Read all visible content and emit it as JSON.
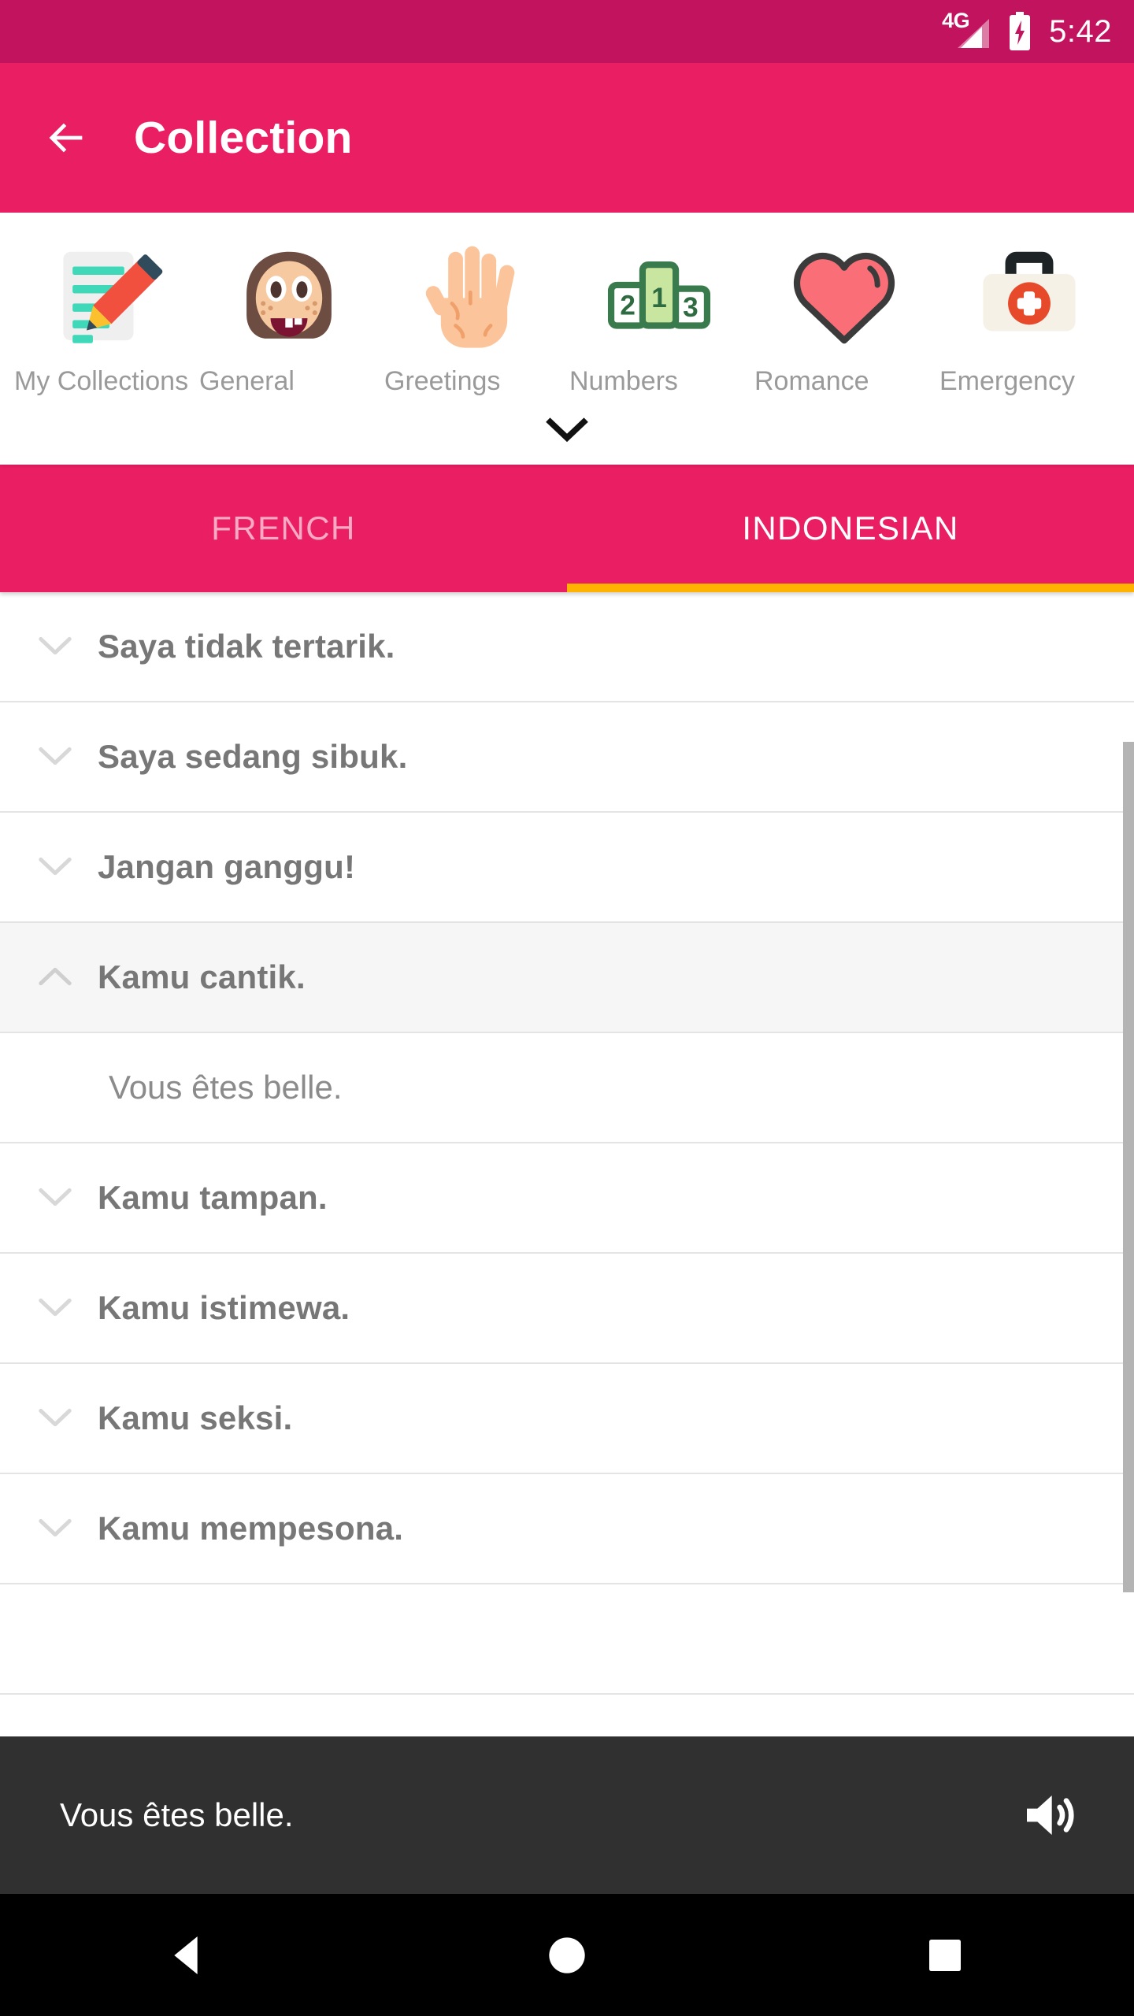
{
  "status_bar": {
    "network_label": "4G",
    "time": "5:42",
    "battery_state": "charging"
  },
  "app_bar": {
    "back_label": "Back",
    "title": "Collection"
  },
  "categories": {
    "expand_label": "Show more categories",
    "items": [
      {
        "label": "My Collections",
        "icon": "memo-pencil-icon"
      },
      {
        "label": "General",
        "icon": "child-face-icon"
      },
      {
        "label": "Greetings",
        "icon": "raised-hand-icon"
      },
      {
        "label": "Numbers",
        "icon": "podium-icon"
      },
      {
        "label": "Romance",
        "icon": "heart-icon"
      },
      {
        "label": "Emergency",
        "icon": "first-aid-kit-icon"
      }
    ]
  },
  "tabs": {
    "items": [
      {
        "label": "FRENCH",
        "active": false
      },
      {
        "label": "INDONESIAN",
        "active": true
      }
    ],
    "indicator_color": "#FFB300"
  },
  "phrase_list": {
    "rows": [
      {
        "text": "Saya tidak tertarik.",
        "expanded": false
      },
      {
        "text": "Saya sedang sibuk.",
        "expanded": false
      },
      {
        "text": "Jangan ganggu!",
        "expanded": false
      },
      {
        "text": "Kamu cantik.",
        "expanded": true
      },
      {
        "text": "Kamu tampan.",
        "expanded": false
      },
      {
        "text": "Kamu istimewa.",
        "expanded": false
      },
      {
        "text": "Kamu seksi.",
        "expanded": false
      },
      {
        "text": "Kamu mempesona.",
        "expanded": false
      }
    ],
    "translation": "Vous êtes belle."
  },
  "player": {
    "text": "Vous êtes belle.",
    "speaker_icon": "speaker-volume-icon"
  },
  "nav_bar": {
    "back": "back-triangle-icon",
    "home": "home-circle-icon",
    "recents": "recents-square-icon"
  },
  "colors": {
    "status_bar": "#C2135E",
    "app_bar": "#E91E63",
    "tab_indicator": "#FFB300",
    "player_bar": "#303030"
  }
}
